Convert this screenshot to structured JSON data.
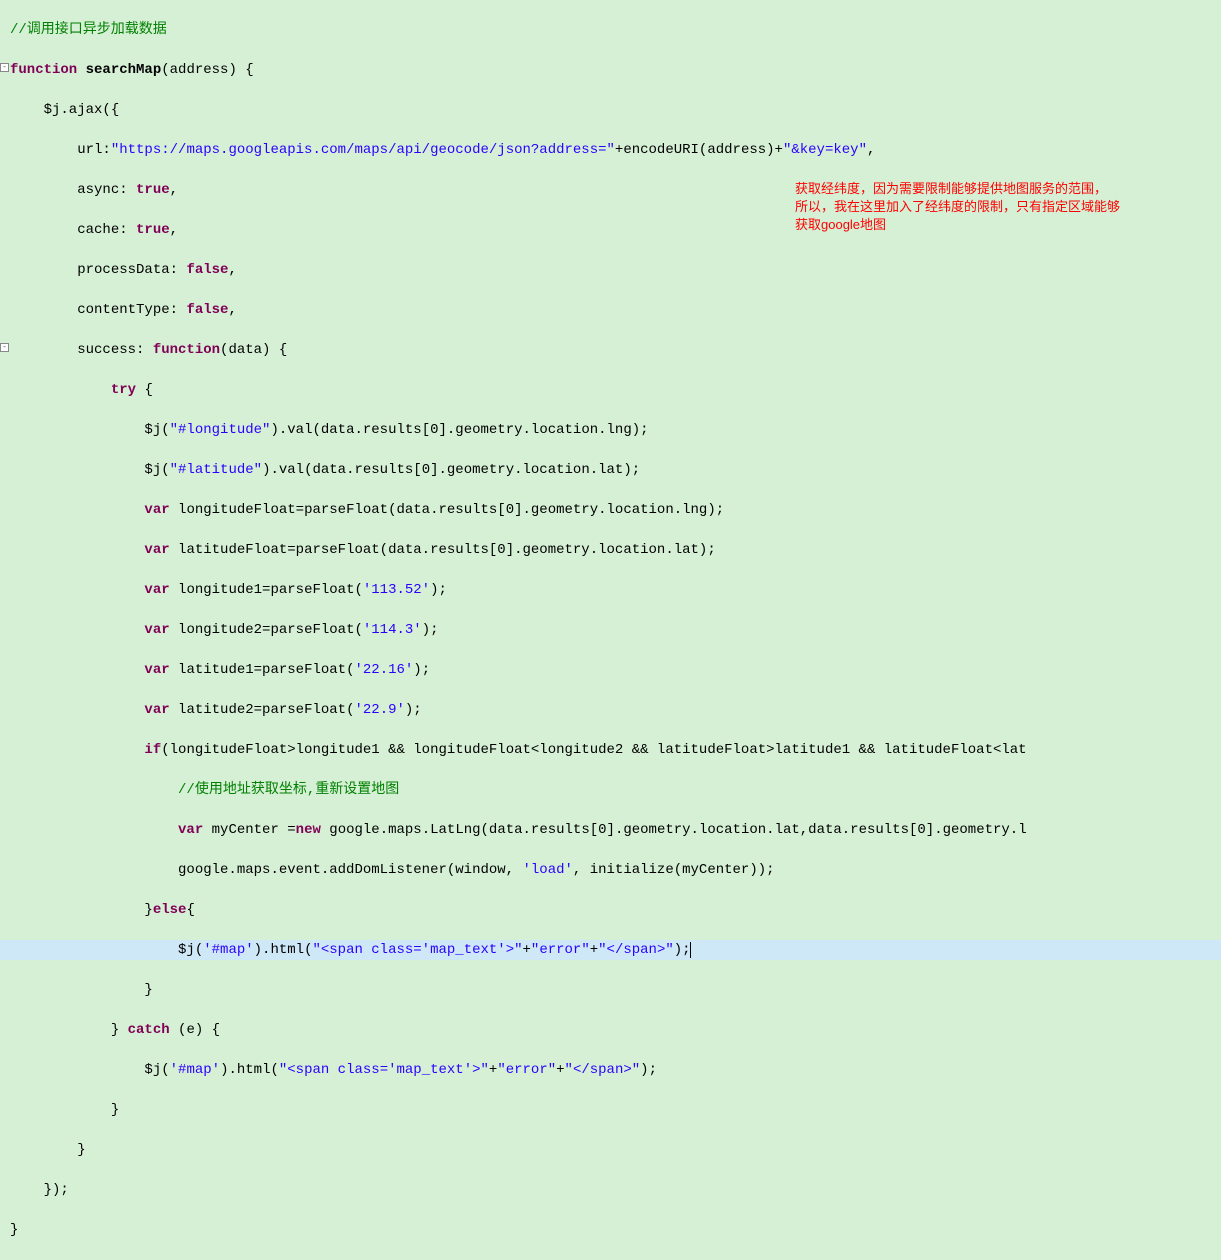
{
  "fold1": "-",
  "fold2": "-",
  "annotation": {
    "line1": "获取经纬度，因为需要限制能够提供地图服务的范围，",
    "line2": "所以，我在这里加入了经纬度的限制，只有指定区域能够",
    "line3": "获取google地图"
  },
  "code": {
    "c01_comment": "//调用接口异步加载数据",
    "c02_fn": "function",
    "c02_name": " searchMap",
    "c02_rest": "(address) {",
    "c03": "    $j.ajax({",
    "c04_pre": "        url:",
    "c04_str1": "\"https://maps.googleapis.com/maps/api/geocode/json?address=\"",
    "c04_mid": "+encodeURI(address)+",
    "c04_str2": "\"&key=key\"",
    "c04_end": ",",
    "c05_pre": "        async: ",
    "c05_kw": "true",
    "c05_end": ",",
    "c06_pre": "        cache: ",
    "c06_kw": "true",
    "c06_end": ",",
    "c07_pre": "        processData: ",
    "c07_kw": "false",
    "c07_end": ",",
    "c08_pre": "        contentType: ",
    "c08_kw": "false",
    "c08_end": ",",
    "c09_pre": "        success: ",
    "c09_fn": "function",
    "c09_rest": "(data) {",
    "c10_pre": "            ",
    "c10_kw": "try",
    "c10_rest": " {",
    "c11_pre": "                $j(",
    "c11_str": "\"#longitude\"",
    "c11_rest": ").val(data.results[0].geometry.location.lng);",
    "c12_pre": "                $j(",
    "c12_str": "\"#latitude\"",
    "c12_rest": ").val(data.results[0].geometry.location.lat);",
    "c13_pre": "                ",
    "c13_kw": "var",
    "c13_rest": " longitudeFloat=parseFloat(data.results[0].geometry.location.lng);",
    "c14_pre": "                ",
    "c14_kw": "var",
    "c14_rest": " latitudeFloat=parseFloat(data.results[0].geometry.location.lat);",
    "c15_pre": "                ",
    "c15_kw": "var",
    "c15_mid": " longitude1=parseFloat(",
    "c15_str": "'113.52'",
    "c15_end": ");",
    "c16_pre": "                ",
    "c16_kw": "var",
    "c16_mid": " longitude2=parseFloat(",
    "c16_str": "'114.3'",
    "c16_end": ");",
    "c17_pre": "                ",
    "c17_kw": "var",
    "c17_mid": " latitude1=parseFloat(",
    "c17_str": "'22.16'",
    "c17_end": ");",
    "c18_pre": "                ",
    "c18_kw": "var",
    "c18_mid": " latitude2=parseFloat(",
    "c18_str": "'22.9'",
    "c18_end": ");",
    "c19_pre": "                ",
    "c19_kw": "if",
    "c19_rest": "(longitudeFloat>longitude1 && longitudeFloat<longitude2 && latitudeFloat>latitude1 && latitudeFloat<lat",
    "c20_pre": "                    ",
    "c20_comment": "//使用地址获取坐标,重新设置地图",
    "c21_pre": "                    ",
    "c21_kw": "var",
    "c21_mid": " myCenter =",
    "c21_kw2": "new",
    "c21_rest": " google.maps.LatLng(data.results[0].geometry.location.lat,data.results[0].geometry.l",
    "c22_pre": "                    google.maps.event.addDomListener(window, ",
    "c22_str": "'load'",
    "c22_rest": ", initialize(myCenter));",
    "c23_pre": "                }",
    "c23_kw": "else",
    "c23_rest": "{",
    "c24_pre": "                    $j(",
    "c24_str1": "'#map'",
    "c24_mid1": ").html(",
    "c24_str2": "\"<span class='map_text'>\"",
    "c24_mid2": "+",
    "c24_str3": "\"error\"",
    "c24_mid3": "+",
    "c24_str4": "\"</span>\"",
    "c24_end": ");",
    "c25": "                }",
    "c26_pre": "            } ",
    "c26_kw": "catch",
    "c26_rest": " (e) {",
    "c27_pre": "                $j(",
    "c27_str1": "'#map'",
    "c27_mid1": ").html(",
    "c27_str2": "\"<span class='map_text'>\"",
    "c27_mid2": "+",
    "c27_str3": "\"error\"",
    "c27_mid3": "+",
    "c27_str4": "\"</span>\"",
    "c27_end": ");",
    "c28": "            }",
    "c29": "        }",
    "c30": "    });",
    "c31": "}"
  }
}
